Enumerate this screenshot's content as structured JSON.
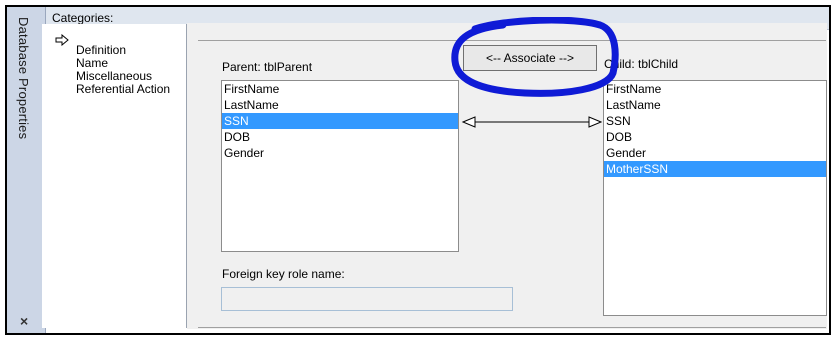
{
  "side_tab": {
    "label": "Database Properties",
    "close_icon": "×"
  },
  "categories": {
    "title": "Categories:",
    "items": [
      {
        "label": "Definition",
        "selected": true
      },
      {
        "label": "Name"
      },
      {
        "label": "Miscellaneous"
      },
      {
        "label": "Referential Action"
      }
    ],
    "selected_marker_icon": "arrow-right-icon"
  },
  "association": {
    "parent_label": "Parent: tblParent",
    "child_label": "Child: tblChild",
    "associate_button": "<-- Associate -->",
    "parent_fields": [
      "FirstName",
      "LastName",
      "SSN",
      "DOB",
      "Gender"
    ],
    "parent_selected": "SSN",
    "child_fields": [
      "FirstName",
      "LastName",
      "SSN",
      "DOB",
      "Gender",
      "MotherSSN"
    ],
    "child_selected": "MotherSSN",
    "foreign_key_label": "Foreign key role name:",
    "foreign_key_value": ""
  },
  "colors": {
    "selection": "#3399ff",
    "annotation": "#0f1bd6",
    "side_tab": "#ccd6e6"
  }
}
